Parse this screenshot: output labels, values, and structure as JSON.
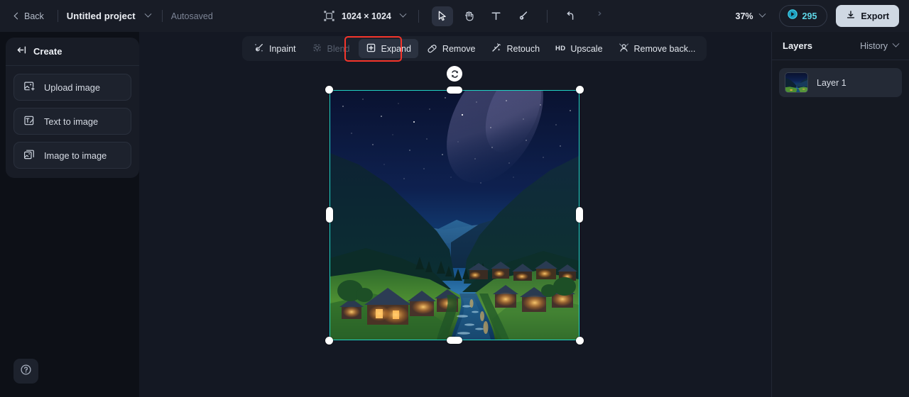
{
  "topbar": {
    "back_label": "Back",
    "project_name": "Untitled project",
    "autosave_label": "Autosaved",
    "canvas_size": "1024 × 1024",
    "zoom_level": "37%",
    "credits_count": "295",
    "export_label": "Export",
    "tools": [
      {
        "name": "select-tool",
        "icon": "cursor-icon",
        "active": true
      },
      {
        "name": "hand-tool",
        "icon": "hand-icon",
        "active": false
      },
      {
        "name": "text-tool",
        "icon": "text-icon",
        "active": false
      },
      {
        "name": "brush-tool",
        "icon": "brush-icon",
        "active": false
      },
      {
        "name": "undo",
        "icon": "undo-icon",
        "active": false
      },
      {
        "name": "redo",
        "icon": "redo-icon",
        "active": false
      }
    ]
  },
  "left_panel": {
    "title": "Create",
    "collapse_icon": "collapse-panel-icon",
    "items": [
      {
        "label": "Upload image",
        "icon": "upload-image-icon"
      },
      {
        "label": "Text to image",
        "icon": "text-to-image-icon"
      },
      {
        "label": "Image to image",
        "icon": "image-to-image-icon"
      }
    ],
    "help_icon": "question-mark-icon"
  },
  "edit_toolbar": {
    "items": [
      {
        "label": "Inpaint",
        "icon": "inpaint-icon",
        "state": "normal"
      },
      {
        "label": "Blend",
        "icon": "blend-icon",
        "state": "disabled"
      },
      {
        "label": "Expand",
        "icon": "expand-icon",
        "state": "selected"
      },
      {
        "label": "Remove",
        "icon": "remove-icon",
        "state": "normal"
      },
      {
        "label": "Retouch",
        "icon": "retouch-icon",
        "state": "normal"
      },
      {
        "label": "Upscale",
        "icon": "hd-icon",
        "state": "normal",
        "badge": "HD"
      },
      {
        "label": "Remove back...",
        "icon": "remove-background-icon",
        "state": "normal"
      }
    ],
    "highlight_target": "Expand",
    "highlight_color": "#f5352b"
  },
  "right_panel": {
    "title": "Layers",
    "history_label": "History",
    "layers": [
      {
        "name": "Layer 1",
        "selected": true
      }
    ]
  },
  "canvas": {
    "selection": {
      "rotate_handle_icon": "rotate-icon"
    },
    "colors": {
      "selection_border": "#20d2c4",
      "canvas_bg": "#141823",
      "accent": "#5fd8e8"
    },
    "artwork_description": "Night-time alpine valley with starry Milky Way sky, dark forested mountains, lit wooden village houses and a stream"
  }
}
